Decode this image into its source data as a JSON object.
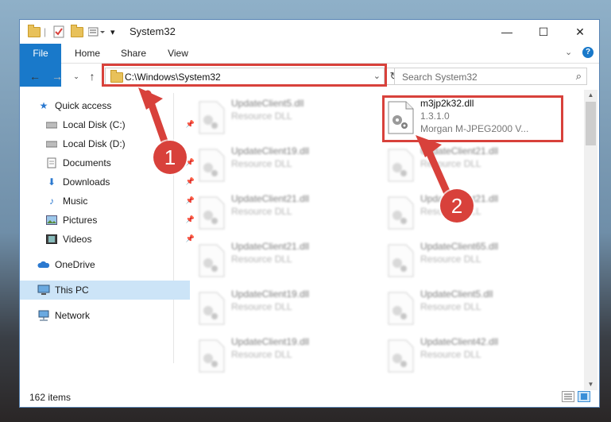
{
  "window": {
    "title": "System32",
    "controls": {
      "minimize": "—",
      "maximize": "☐",
      "close": "✕"
    }
  },
  "ribbon": {
    "tabs": [
      "File",
      "Home",
      "Share",
      "View"
    ]
  },
  "address": {
    "path": "C:\\Windows\\System32",
    "search_placeholder": "Search System32"
  },
  "sidebar": {
    "items": [
      {
        "label": "Quick access",
        "icon": "star-icon",
        "pinned": false
      },
      {
        "label": "Local Disk (C:)",
        "icon": "drive-icon",
        "pinned": true
      },
      {
        "label": "Local Disk (D:)",
        "icon": "drive-icon",
        "pinned": false
      },
      {
        "label": "Documents",
        "icon": "documents-icon",
        "pinned": true
      },
      {
        "label": "Downloads",
        "icon": "download-icon",
        "pinned": true
      },
      {
        "label": "Music",
        "icon": "music-icon",
        "pinned": true
      },
      {
        "label": "Pictures",
        "icon": "pictures-icon",
        "pinned": true
      },
      {
        "label": "Videos",
        "icon": "videos-icon",
        "pinned": true
      },
      {
        "label": "OneDrive",
        "icon": "cloud-icon",
        "pinned": false
      },
      {
        "label": "This PC",
        "icon": "computer-icon",
        "pinned": false
      },
      {
        "label": "Network",
        "icon": "network-icon",
        "pinned": false
      }
    ]
  },
  "files": {
    "highlighted": {
      "name": "m3jp2k32.dll",
      "version": "1.3.1.0",
      "company": "Morgan M-JPEG2000 V..."
    },
    "left_column": [
      {
        "name": "UpdateClient5.dll",
        "type": "Resource DLL"
      },
      {
        "name": "UpdateClient19.dll",
        "type": "Resource DLL"
      },
      {
        "name": "UpdateClient21.dll",
        "type": "Resource DLL"
      },
      {
        "name": "UpdateClient21.dll",
        "type": "Resource DLL"
      },
      {
        "name": "UpdateClient19.dll",
        "type": "Resource DLL"
      },
      {
        "name": "UpdateClient19.dll",
        "type": "Resource DLL"
      }
    ],
    "right_column": [
      {
        "name": "UpdateClient21.dll",
        "type": "Resource DLL"
      },
      {
        "name": "UpdateClient21.dll",
        "type": "Resource DLL"
      },
      {
        "name": "UpdateClient65.dll",
        "type": "Resource DLL"
      },
      {
        "name": "UpdateClient5.dll",
        "type": "Resource DLL"
      },
      {
        "name": "UpdateClient42.dll",
        "type": "Resource DLL"
      }
    ]
  },
  "status": {
    "item_count": "162 items"
  },
  "callouts": {
    "one": "1",
    "two": "2"
  },
  "colors": {
    "accent": "#1979ca",
    "highlight_red": "#d8413b",
    "selection": "#cce4f7"
  }
}
